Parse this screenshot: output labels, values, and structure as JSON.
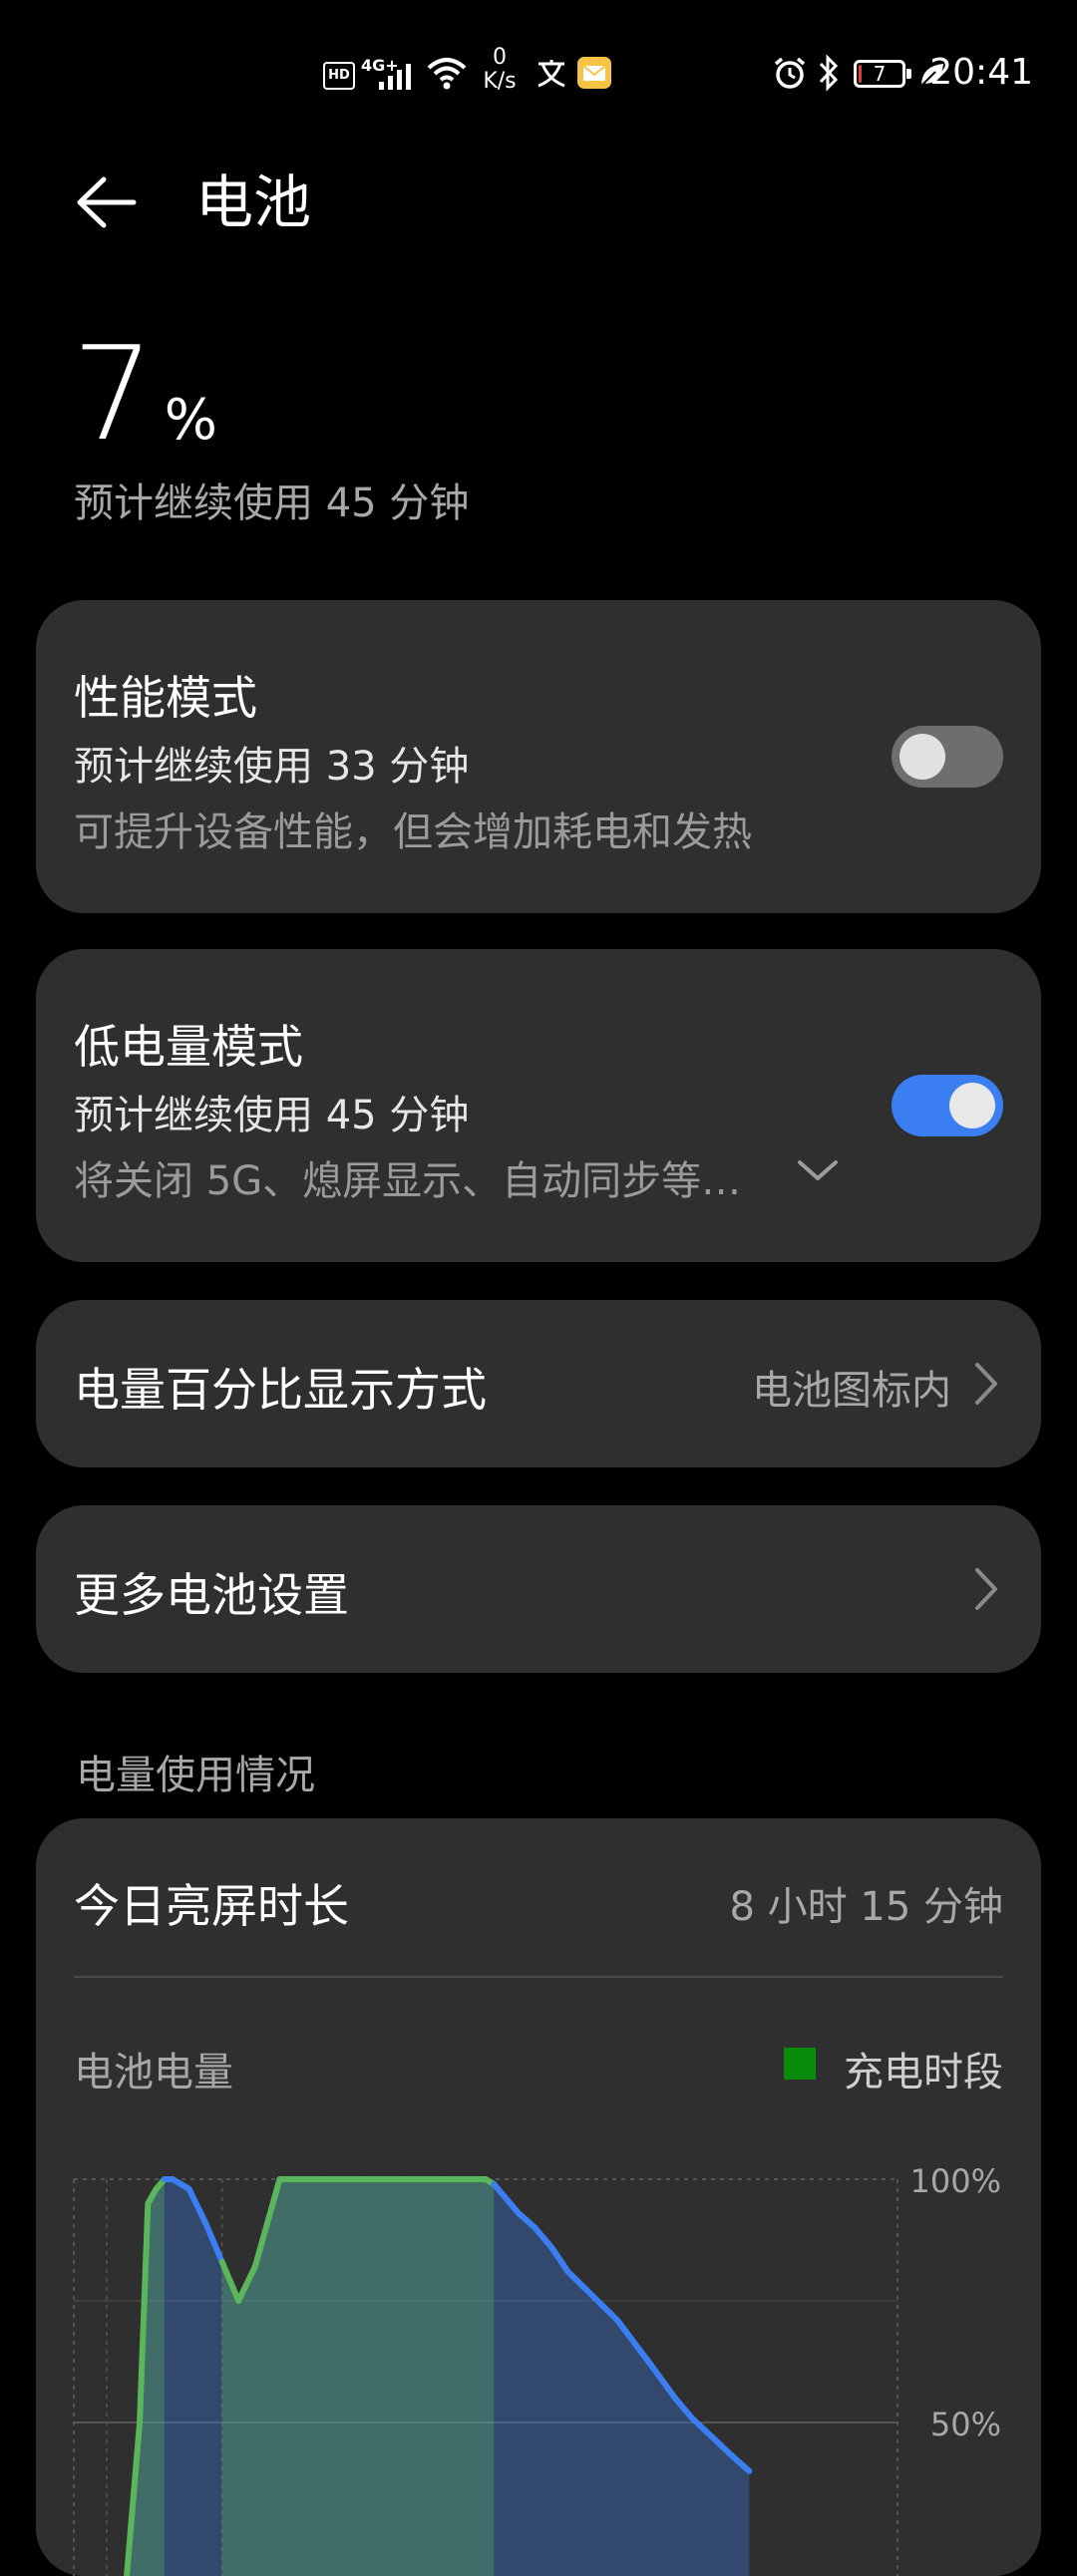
{
  "status_bar": {
    "hd": "HD",
    "network": "4G+",
    "net_speed_value": "0",
    "net_speed_unit": "K/s",
    "battery_level": "7",
    "time": "20:41",
    "colors": {
      "battery_low": "#e53935",
      "mail": "#f6c344"
    },
    "icons": [
      "hd-icon",
      "signal-icon",
      "wifi-icon",
      "net-speed",
      "translate-icon",
      "mail-icon",
      "alarm-icon",
      "bluetooth-icon",
      "battery-icon",
      "eco-icon"
    ]
  },
  "header": {
    "title": "电池"
  },
  "battery": {
    "percent": "7",
    "percent_sign": "%",
    "estimate": "预计继续使用 45 分钟"
  },
  "performance_mode": {
    "title": "性能模式",
    "estimate": "预计继续使用 33 分钟",
    "description": "可提升设备性能，但会增加耗电和发热",
    "enabled": false
  },
  "low_power_mode": {
    "title": "低电量模式",
    "estimate": "预计继续使用 45 分钟",
    "description": "将关闭 5G、熄屏显示、自动同步等…",
    "enabled": true
  },
  "percentage_display": {
    "title": "电量百分比显示方式",
    "value": "电池图标内"
  },
  "more_settings": {
    "title": "更多电池设置"
  },
  "usage": {
    "section_label": "电量使用情况",
    "screen_time_label": "今日亮屏时长",
    "screen_time_value": "8 小时 15 分钟",
    "battery_level_label": "电池电量",
    "legend_charging": "充电时段",
    "colors": {
      "accent": "#3a7ef2",
      "charging_line": "#5bb55b",
      "legend": "#0a8a0a"
    }
  },
  "chart_data": {
    "type": "area",
    "title": "电池电量",
    "y_ticks": [
      "100%",
      "50%"
    ],
    "ylim": [
      0,
      100
    ],
    "x": [
      0,
      2,
      4,
      6,
      8,
      9,
      10,
      11,
      12,
      14,
      16,
      18,
      19,
      20,
      22,
      25,
      30,
      35,
      40,
      45,
      50,
      51,
      52,
      54,
      56,
      58,
      60,
      63,
      66,
      70,
      73,
      75,
      80,
      82
    ],
    "series": [
      {
        "values": [
          2,
          2,
          0,
          10,
          50,
          95,
          98,
          100,
          100,
          98,
          91,
          83,
          79,
          75,
          82,
          100,
          100,
          100,
          100,
          100,
          100,
          99,
          97,
          93,
          90,
          86,
          81,
          76,
          71,
          62,
          55,
          51,
          43,
          40
        ]
      }
    ],
    "charging_periods": [
      [
        4,
        11
      ],
      [
        18,
        51
      ]
    ]
  }
}
